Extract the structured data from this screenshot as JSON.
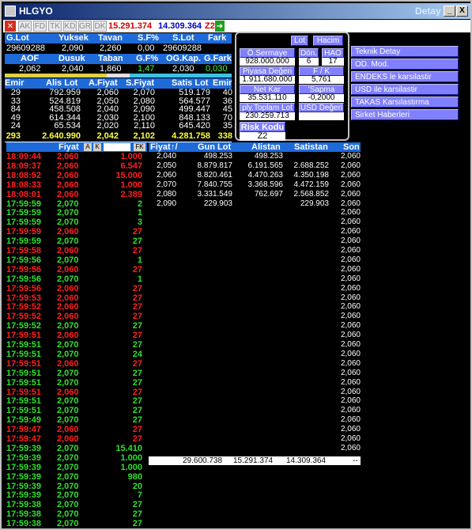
{
  "window": {
    "title": "HLGYO",
    "detay": "Detay",
    "minimize": "_",
    "close": "X"
  },
  "toolbar": {
    "buttons": [
      "AK",
      "FD",
      "TK",
      "KD",
      "GR",
      "DK"
    ],
    "val1": "15.291.374",
    "val2": "14.309.364",
    "z": "Z2"
  },
  "summary": {
    "headers1": [
      "G.Lot",
      "Yuksek",
      "Tavan",
      "S.F%",
      "S.Lot",
      "Fark"
    ],
    "values1": [
      "29609288",
      "2,090",
      "2,260",
      "0,00",
      "29609288",
      ""
    ],
    "headers2": [
      "AOF",
      "Dusuk",
      "Taban",
      "G.F%",
      "OG.Kap.",
      "G.Fark"
    ],
    "values2": [
      "2,062",
      "2,040",
      "1,860",
      "1,47",
      "2,030",
      "0,030"
    ],
    "headers3": [
      "Emir",
      "Alis Lot",
      "A.Fiyat",
      "S.Fiyat",
      "Satis Lot",
      "Emir"
    ],
    "depth": [
      [
        "29",
        "792.959",
        "2,060",
        "2,070",
        "519.179",
        "40"
      ],
      [
        "33",
        "524.819",
        "2,050",
        "2,080",
        "564.577",
        "36"
      ],
      [
        "84",
        "458.508",
        "2,040",
        "2,090",
        "499.447",
        "45"
      ],
      [
        "49",
        "614.344",
        "2,030",
        "2,100",
        "848.133",
        "70"
      ],
      [
        "24",
        "65.534",
        "2,020",
        "2,110",
        "645.420",
        "35"
      ]
    ],
    "totals": [
      "293",
      "2.640.990",
      "2,042",
      "2,102",
      "4.281.758",
      "338"
    ]
  },
  "info": {
    "lot_btn": "Lot",
    "hacim_btn": "Hacim",
    "sermaye_label": "Ö.Sermaye",
    "sermaye_val": "928.000.000",
    "don_label": "Dön.",
    "don_val": "6",
    "hao_label": "HAO",
    "hao_val": "17",
    "piyasa_label": "Piyasa Değeri",
    "piyasa_val": "1.911.680.000",
    "fk_label": "F / K",
    "fk_val": "5,761",
    "netkar_label": "Net Kar",
    "netkar_val": "35.531.110",
    "sapma_label": "'Sapma",
    "sapma_val": "-0,2000",
    "toplamlot_label": "ply.Toplam Lot",
    "toplamlot_val": "230.259.713",
    "usd_label": "USD Değeri",
    "usd_val": "",
    "risk_label": "Risk Kodu",
    "risk_val": "Z2"
  },
  "menu": [
    "Teknik Detay",
    "OD. Mod.",
    "ENDEKS le karsilastir",
    "USD ile karsilastir",
    "TAKAS Karsılastırma",
    "Sirket Haberleri"
  ],
  "trades_header": {
    "fiyat": "Fiyat",
    "a": "A",
    "k": "K",
    "fk": "FK"
  },
  "trades": [
    [
      "18:09:44",
      "2,060",
      "1.000",
      "r"
    ],
    [
      "18:09:37",
      "2,060",
      "6.547",
      "r"
    ],
    [
      "18:08:52",
      "2,060",
      "15.000",
      "r"
    ],
    [
      "18:08:33",
      "2,060",
      "1.000",
      "r"
    ],
    [
      "18:08:01",
      "2,060",
      "2.389",
      "r"
    ],
    [
      "17:59:59",
      "2,070",
      "2",
      "g"
    ],
    [
      "17:59:59",
      "2,070",
      "1",
      "g"
    ],
    [
      "17:59:59",
      "2,070",
      "3",
      "g"
    ],
    [
      "17:59:59",
      "2,060",
      "27",
      "r"
    ],
    [
      "17:59:59",
      "2,070",
      "27",
      "g"
    ],
    [
      "17:59:58",
      "2,060",
      "27",
      "r"
    ],
    [
      "17:59:56",
      "2,070",
      "1",
      "g"
    ],
    [
      "17:59:56",
      "2,060",
      "27",
      "r"
    ],
    [
      "17:59:56",
      "2,070",
      "1",
      "g"
    ],
    [
      "17:59:56",
      "2,060",
      "27",
      "r"
    ],
    [
      "17:59:53",
      "2,060",
      "27",
      "r"
    ],
    [
      "17:59:52",
      "2,060",
      "27",
      "r"
    ],
    [
      "17:59:52",
      "2,060",
      "27",
      "r"
    ],
    [
      "17:59:52",
      "2,070",
      "27",
      "g"
    ],
    [
      "17:59:51",
      "2,060",
      "27",
      "r"
    ],
    [
      "17:59:51",
      "2,070",
      "27",
      "g"
    ],
    [
      "17:59:51",
      "2,070",
      "24",
      "g"
    ],
    [
      "17:59:51",
      "2,060",
      "27",
      "r"
    ],
    [
      "17:59:51",
      "2,070",
      "27",
      "g"
    ],
    [
      "17:59:51",
      "2,070",
      "27",
      "g"
    ],
    [
      "17:59:51",
      "2,060",
      "27",
      "r"
    ],
    [
      "17:59:51",
      "2,070",
      "27",
      "g"
    ],
    [
      "17:59:51",
      "2,070",
      "27",
      "g"
    ],
    [
      "17:59:49",
      "2,070",
      "27",
      "g"
    ],
    [
      "17:59:47",
      "2,060",
      "27",
      "r"
    ],
    [
      "17:59:47",
      "2,060",
      "27",
      "r"
    ],
    [
      "17:59:39",
      "2,070",
      "15.410",
      "g"
    ],
    [
      "17:59:39",
      "2,070",
      "1.000",
      "g"
    ],
    [
      "17:59:39",
      "2,070",
      "1.000",
      "g"
    ],
    [
      "17:59:39",
      "2,070",
      "980",
      "g"
    ],
    [
      "17:59:39",
      "2,070",
      "20",
      "g"
    ],
    [
      "17:59:39",
      "2,070",
      "7",
      "g"
    ],
    [
      "17:59:38",
      "2,070",
      "27",
      "g"
    ],
    [
      "17:59:38",
      "2,070",
      "27",
      "g"
    ],
    [
      "17:59:38",
      "2,070",
      "27",
      "g"
    ]
  ],
  "dist_header": {
    "fiyat": "Fiyat",
    "arrows": "↑/",
    "gunlot": "Gun Lot",
    "alistan": "Alistan",
    "satistan": "Satistan",
    "son": "Son"
  },
  "dist": [
    [
      "2,040",
      "498.253",
      "498.253",
      ""
    ],
    [
      "2,050",
      "8.879.817",
      "6.191.565",
      "2.688.252"
    ],
    [
      "2,060",
      "8.820.461",
      "4.470.263",
      "4.350.198"
    ],
    [
      "2,070",
      "7.840.755",
      "3.368.596",
      "4.472.159"
    ],
    [
      "2,080",
      "3.331.549",
      "762.697",
      "2.568.852"
    ],
    [
      "2,090",
      "229.903",
      "",
      "229.903"
    ]
  ],
  "son_values": [
    "2,060",
    "2,060",
    "2,060",
    "2,060",
    "2,060",
    "2,060",
    "2,060",
    "2,060",
    "2,060",
    "2,060",
    "2,060",
    "2,060",
    "2,060",
    "2,060",
    "2,060",
    "2,060",
    "2,060",
    "2,060",
    "2,060",
    "2,060",
    "2,060",
    "2,060",
    "2,060",
    "2,060",
    "2,060",
    "2,060",
    "2,060",
    "2,060",
    "2,060",
    "2,060",
    "2,060",
    "2,060"
  ],
  "dist_totals": {
    "gun": "29.600.738",
    "alis": "15.291.374",
    "satis": "14.309.364",
    "end": "--"
  }
}
